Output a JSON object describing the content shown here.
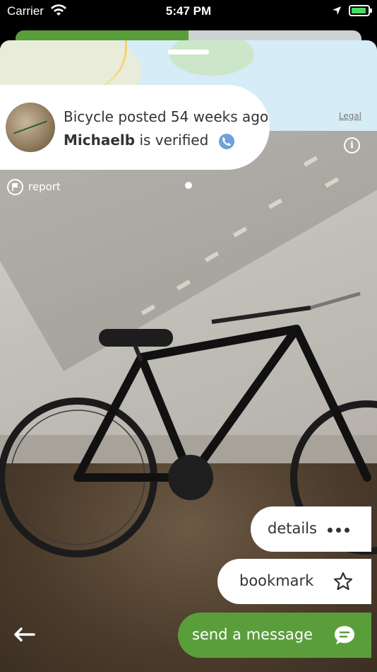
{
  "status_bar": {
    "carrier": "Carrier",
    "time": "5:47 PM"
  },
  "listing": {
    "posted_text": "Bicycle posted 54 weeks ago",
    "seller_name": "Michaelb",
    "verified_suffix": "is verified",
    "progress_fraction": 0.5
  },
  "map": {
    "legal_label": "Legal"
  },
  "actions": {
    "report_label": "report",
    "details_label": "details",
    "bookmark_label": "bookmark",
    "send_label": "send a message"
  },
  "colors": {
    "brand_green": "#5a9e3c",
    "verified_blue": "#6fa0d8"
  },
  "icons": {
    "wifi": "wifi-icon",
    "location": "location-arrow-icon",
    "battery": "battery-icon",
    "phone": "phone-icon",
    "info": "info-icon",
    "flag": "flag-icon",
    "more": "more-dots-icon",
    "star": "star-icon",
    "chat": "chat-bubble-icon",
    "back": "back-arrow-icon"
  }
}
